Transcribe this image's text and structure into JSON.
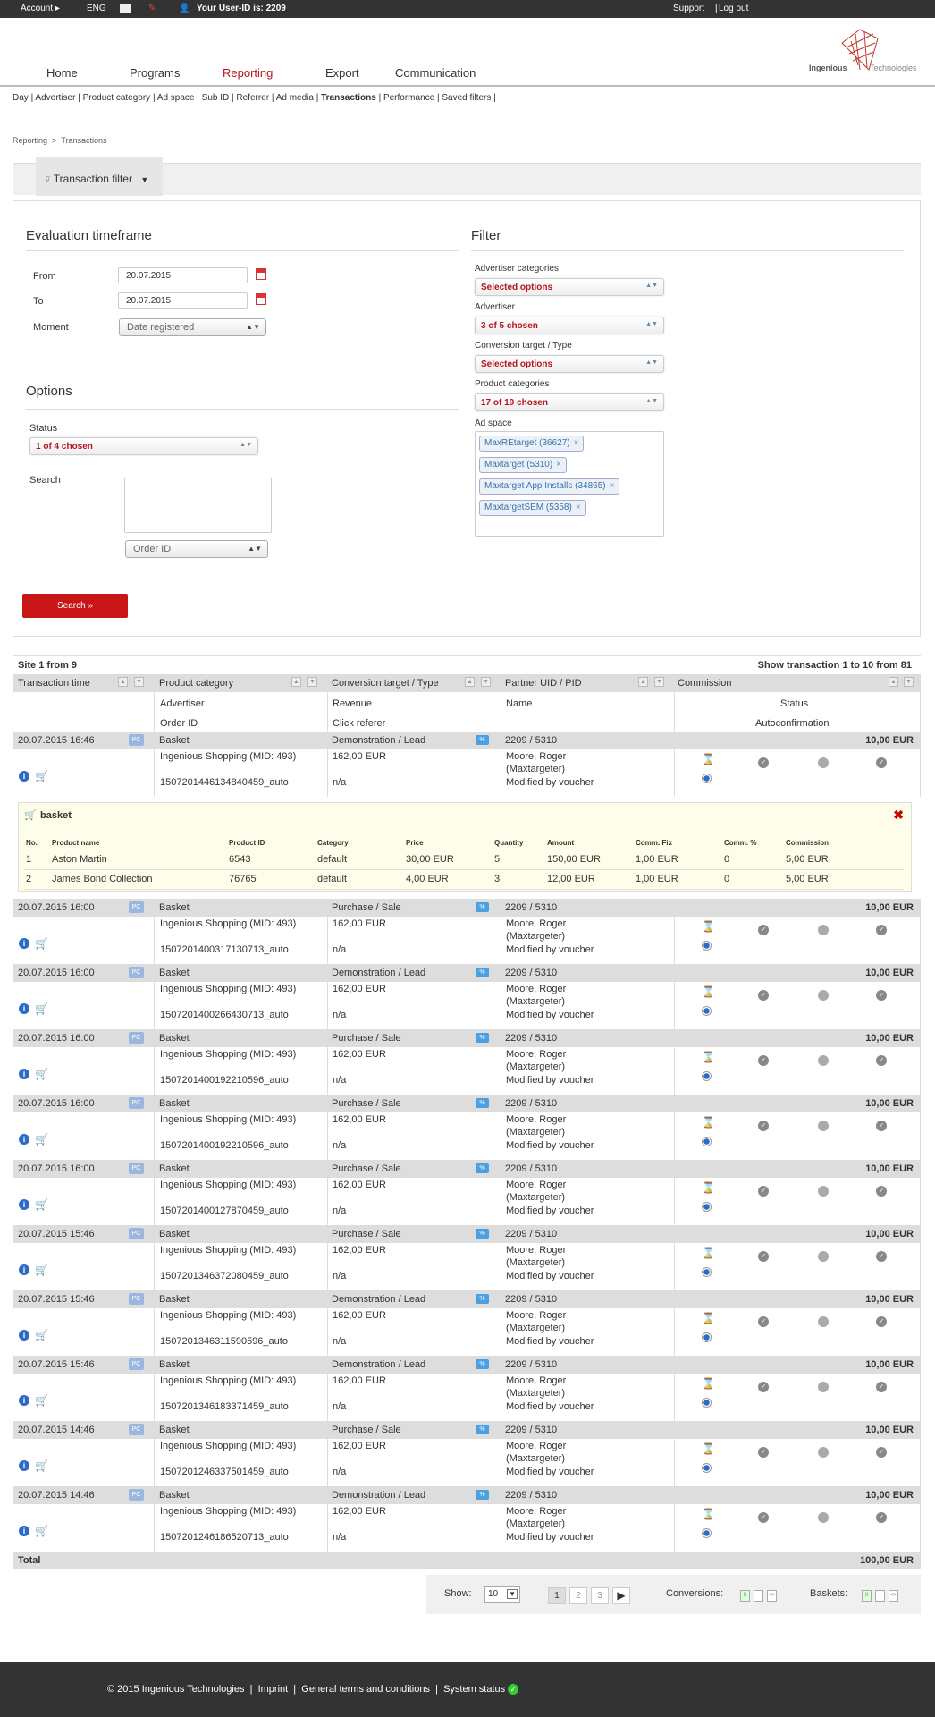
{
  "topbar": {
    "account": "Account",
    "lang": "ENG",
    "user_label": "Your User-ID is:",
    "user_id": "2209",
    "support": "Support",
    "logout": "Log out"
  },
  "nav": {
    "home": "Home",
    "programs": "Programs",
    "reporting": "Reporting",
    "export": "Export",
    "communication": "Communication"
  },
  "logo": {
    "name1": "Ingenious",
    "name2": "Technologies"
  },
  "subnav": [
    "Day",
    "Advertiser",
    "Product category",
    "Ad space",
    "Sub ID",
    "Referrer",
    "Ad media",
    "Transactions",
    "Performance",
    "Saved filters"
  ],
  "breadcrumb": {
    "parent": "Reporting",
    "sep": ">",
    "current": "Transactions"
  },
  "filter_tab": "Transaction filter",
  "timeframe": {
    "title": "Evaluation timeframe",
    "from_label": "From",
    "from": "20.07.2015",
    "to_label": "To",
    "to": "20.07.2015",
    "moment_label": "Moment",
    "moment": "Date registered"
  },
  "options": {
    "title": "Options",
    "status_label": "Status",
    "status": "1 of 4 chosen",
    "search_label": "Search",
    "search_by": "Order ID",
    "search_btn": "Search »"
  },
  "filter": {
    "title": "Filter",
    "adv_cat_label": "Advertiser categories",
    "adv_cat": "Selected options",
    "adv_label": "Advertiser",
    "adv": "3 of 5 chosen",
    "conv_label": "Conversion target / Type",
    "conv": "Selected options",
    "prod_label": "Product categories",
    "prod": "17 of 19 chosen",
    "adspace_label": "Ad space",
    "tags": [
      "MaxREtarget (36627)",
      "Maxtarget (5310)",
      "Maxtarget App Installs (34865)",
      "MaxtargetSEM (5358)"
    ]
  },
  "results": {
    "site": "Site 1 from 9",
    "show": "Show transaction 1 to 10 from 81"
  },
  "columns": {
    "time": "Transaction time",
    "prodcat": "Product category",
    "conv": "Conversion target / Type",
    "partner": "Partner UID / PID",
    "commission": "Commission",
    "advertiser": "Advertiser",
    "order": "Order ID",
    "revenue": "Revenue",
    "click": "Click referer",
    "name": "Name",
    "status": "Status",
    "autoconf": "Autoconfirmation"
  },
  "rows": [
    {
      "time": "20.07.2015 16:46",
      "cat": "Basket",
      "conv": "Demonstration / Lead",
      "partner": "2209 / 5310",
      "amount": "10,00 EUR",
      "adv": "Ingenious Shopping (MID: 493)",
      "rev": "162,00 EUR",
      "order": "1507201446134840459_auto",
      "ref": "n/a",
      "name1": "Moore, Roger",
      "name2": "(Maxtargeter)",
      "mod": "Modified by voucher"
    },
    {
      "time": "20.07.2015 16:00",
      "cat": "Basket",
      "conv": "Purchase / Sale",
      "partner": "2209 / 5310",
      "amount": "10,00 EUR",
      "adv": "Ingenious Shopping (MID: 493)",
      "rev": "162,00 EUR",
      "order": "1507201400317130713_auto",
      "ref": "n/a",
      "name1": "Moore, Roger",
      "name2": "(Maxtargeter)",
      "mod": "Modified by voucher"
    },
    {
      "time": "20.07.2015 16:00",
      "cat": "Basket",
      "conv": "Demonstration / Lead",
      "partner": "2209 / 5310",
      "amount": "10,00 EUR",
      "adv": "Ingenious Shopping (MID: 493)",
      "rev": "162,00 EUR",
      "order": "1507201400266430713_auto",
      "ref": "n/a",
      "name1": "Moore, Roger",
      "name2": "(Maxtargeter)",
      "mod": "Modified by voucher"
    },
    {
      "time": "20.07.2015 16:00",
      "cat": "Basket",
      "conv": "Purchase / Sale",
      "partner": "2209 / 5310",
      "amount": "10,00 EUR",
      "adv": "Ingenious Shopping (MID: 493)",
      "rev": "162,00 EUR",
      "order": "1507201400192210596_auto",
      "ref": "n/a",
      "name1": "Moore, Roger",
      "name2": "(Maxtargeter)",
      "mod": "Modified by voucher"
    },
    {
      "time": "20.07.2015 16:00",
      "cat": "Basket",
      "conv": "Purchase / Sale",
      "partner": "2209 / 5310",
      "amount": "10,00 EUR",
      "adv": "Ingenious Shopping (MID: 493)",
      "rev": "162,00 EUR",
      "order": "1507201400192210596_auto",
      "ref": "n/a",
      "name1": "Moore, Roger",
      "name2": "(Maxtargeter)",
      "mod": "Modified by voucher"
    },
    {
      "time": "20.07.2015 16:00",
      "cat": "Basket",
      "conv": "Purchase / Sale",
      "partner": "2209 / 5310",
      "amount": "10,00 EUR",
      "adv": "Ingenious Shopping (MID: 493)",
      "rev": "162,00 EUR",
      "order": "1507201400127870459_auto",
      "ref": "n/a",
      "name1": "Moore, Roger",
      "name2": "(Maxtargeter)",
      "mod": "Modified by voucher"
    },
    {
      "time": "20.07.2015 15:46",
      "cat": "Basket",
      "conv": "Purchase / Sale",
      "partner": "2209 / 5310",
      "amount": "10,00 EUR",
      "adv": "Ingenious Shopping (MID: 493)",
      "rev": "162,00 EUR",
      "order": "1507201346372080459_auto",
      "ref": "n/a",
      "name1": "Moore, Roger",
      "name2": "(Maxtargeter)",
      "mod": "Modified by voucher"
    },
    {
      "time": "20.07.2015 15:46",
      "cat": "Basket",
      "conv": "Demonstration / Lead",
      "partner": "2209 / 5310",
      "amount": "10,00 EUR",
      "adv": "Ingenious Shopping (MID: 493)",
      "rev": "162,00 EUR",
      "order": "1507201346311590596_auto",
      "ref": "n/a",
      "name1": "Moore, Roger",
      "name2": "(Maxtargeter)",
      "mod": "Modified by voucher"
    },
    {
      "time": "20.07.2015 15:46",
      "cat": "Basket",
      "conv": "Demonstration / Lead",
      "partner": "2209 / 5310",
      "amount": "10,00 EUR",
      "adv": "Ingenious Shopping (MID: 493)",
      "rev": "162,00 EUR",
      "order": "1507201346183371459_auto",
      "ref": "n/a",
      "name1": "Moore, Roger",
      "name2": "(Maxtargeter)",
      "mod": "Modified by voucher"
    },
    {
      "time": "20.07.2015 14:46",
      "cat": "Basket",
      "conv": "Purchase / Sale",
      "partner": "2209 / 5310",
      "amount": "10,00 EUR",
      "adv": "Ingenious Shopping (MID: 493)",
      "rev": "162,00 EUR",
      "order": "1507201246337501459_auto",
      "ref": "n/a",
      "name1": "Moore, Roger",
      "name2": "(Maxtargeter)",
      "mod": "Modified by voucher"
    },
    {
      "time": "20.07.2015 14:46",
      "cat": "Basket",
      "conv": "Demonstration / Lead",
      "partner": "2209 / 5310",
      "amount": "10,00 EUR",
      "adv": "Ingenious Shopping (MID: 493)",
      "rev": "162,00 EUR",
      "order": "1507201246186520713_auto",
      "ref": "n/a",
      "name1": "Moore, Roger",
      "name2": "(Maxtargeter)",
      "mod": "Modified by voucher"
    }
  ],
  "basket": {
    "title": "basket",
    "headers": [
      "No.",
      "Product name",
      "Product ID",
      "Category",
      "Price",
      "Quantity",
      "Amount",
      "Comm. Fix",
      "Comm. %",
      "Commission"
    ],
    "items": [
      [
        "1",
        "Aston Martin",
        "6543",
        "default",
        "30,00 EUR",
        "5",
        "150,00 EUR",
        "1,00 EUR",
        "0",
        "5,00 EUR"
      ],
      [
        "2",
        "James Bond Collection",
        "76765",
        "default",
        "4,00 EUR",
        "3",
        "12,00 EUR",
        "1,00 EUR",
        "0",
        "5,00 EUR"
      ]
    ]
  },
  "total": {
    "label": "Total",
    "amount": "100,00 EUR"
  },
  "pager": {
    "show_label": "Show:",
    "per_page": "10",
    "pages": [
      "1",
      "2",
      "3"
    ],
    "conversions": "Conversions:",
    "baskets": "Baskets:"
  },
  "footer": {
    "copyright": "© 2015 Ingenious Technologies",
    "imprint": "Imprint",
    "terms": "General terms and conditions",
    "status": "System status"
  },
  "colors": {
    "accent": "#b5141e",
    "button": "#c81616",
    "row_header": "#dddddd"
  }
}
